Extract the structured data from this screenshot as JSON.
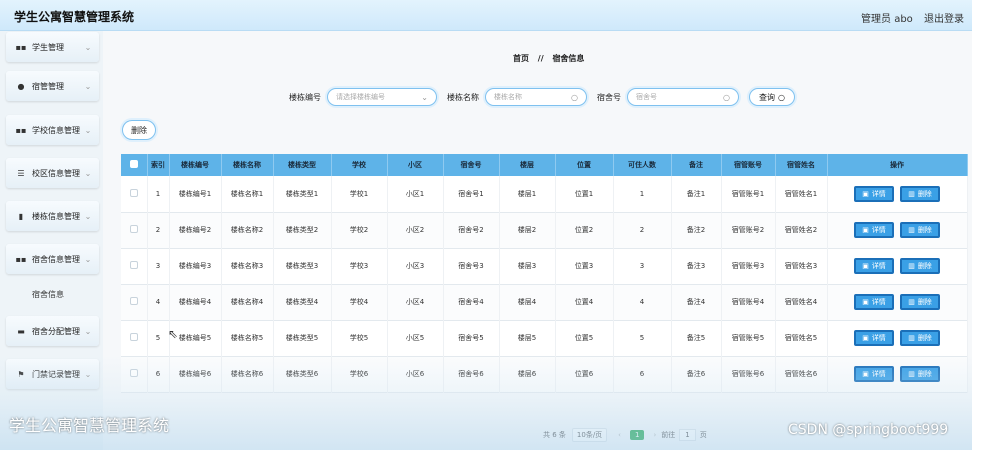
{
  "app": {
    "title": "学生公寓智慧管理系统"
  },
  "topbar": {
    "user": "管理员 abo",
    "logout": "退出登录"
  },
  "sidebar": {
    "items": [
      {
        "label": "学生管理",
        "icon": "grid-icon"
      },
      {
        "label": "宿管管理",
        "icon": "user-icon"
      },
      {
        "label": "学校信息管理",
        "icon": "grid-icon"
      },
      {
        "label": "校区信息管理",
        "icon": "sliders-icon"
      },
      {
        "label": "楼栋信息管理",
        "icon": "bar-chart-icon"
      },
      {
        "label": "宿舍信息管理",
        "icon": "grid-icon"
      },
      {
        "label": "宿舍分配管理",
        "icon": "card-icon"
      },
      {
        "label": "门禁记录管理",
        "icon": "flag-icon"
      }
    ],
    "submenu": {
      "label": "宿舍信息"
    }
  },
  "breadcrumb": {
    "home": "首页",
    "sep": "//",
    "current": "宿舍信息"
  },
  "search": {
    "building_code_label": "楼栋编号",
    "building_code_placeholder": "请选择楼栋编号",
    "building_name_label": "楼栋名称",
    "building_name_placeholder": "楼栋名称",
    "room_label": "宿舍号",
    "room_placeholder": "宿舍号",
    "query_button": "查询"
  },
  "actions": {
    "delete_button": "删除"
  },
  "table": {
    "columns": [
      "索引",
      "楼栋编号",
      "楼栋名称",
      "楼栋类型",
      "学校",
      "小区",
      "宿舍号",
      "楼层",
      "位置",
      "可住人数",
      "备注",
      "宿管账号",
      "宿管姓名",
      "操作"
    ],
    "rows": [
      [
        "1",
        "楼栋编号1",
        "楼栋名称1",
        "楼栋类型1",
        "学校1",
        "小区1",
        "宿舍号1",
        "楼层1",
        "位置1",
        "1",
        "备注1",
        "宿管账号1",
        "宿管姓名1"
      ],
      [
        "2",
        "楼栋编号2",
        "楼栋名称2",
        "楼栋类型2",
        "学校2",
        "小区2",
        "宿舍号2",
        "楼层2",
        "位置2",
        "2",
        "备注2",
        "宿管账号2",
        "宿管姓名2"
      ],
      [
        "3",
        "楼栋编号3",
        "楼栋名称3",
        "楼栋类型3",
        "学校3",
        "小区3",
        "宿舍号3",
        "楼层3",
        "位置3",
        "3",
        "备注3",
        "宿管账号3",
        "宿管姓名3"
      ],
      [
        "4",
        "楼栋编号4",
        "楼栋名称4",
        "楼栋类型4",
        "学校4",
        "小区4",
        "宿舍号4",
        "楼层4",
        "位置4",
        "4",
        "备注4",
        "宿管账号4",
        "宿管姓名4"
      ],
      [
        "5",
        "楼栋编号5",
        "楼栋名称5",
        "楼栋类型5",
        "学校5",
        "小区5",
        "宿舍号5",
        "楼层5",
        "位置5",
        "5",
        "备注5",
        "宿管账号5",
        "宿管姓名5"
      ],
      [
        "6",
        "楼栋编号6",
        "楼栋名称6",
        "楼栋类型6",
        "学校6",
        "小区6",
        "宿舍号6",
        "楼层6",
        "位置6",
        "6",
        "备注6",
        "宿管账号6",
        "宿管姓名6"
      ]
    ],
    "detail_button": "详情",
    "delete_button": "删除"
  },
  "pagination": {
    "total": "共 6 条",
    "page_size": "10条/页",
    "current_page": "1",
    "goto_label": "前往",
    "goto_value": "1",
    "page_suffix": "页"
  },
  "watermark": {
    "title": "学生公寓智慧管理系统",
    "csdn": "CSDN @springboot999"
  },
  "colors": {
    "header": "#5eb3e8",
    "button": "#3aa0e6",
    "active_page": "#17a34a"
  }
}
